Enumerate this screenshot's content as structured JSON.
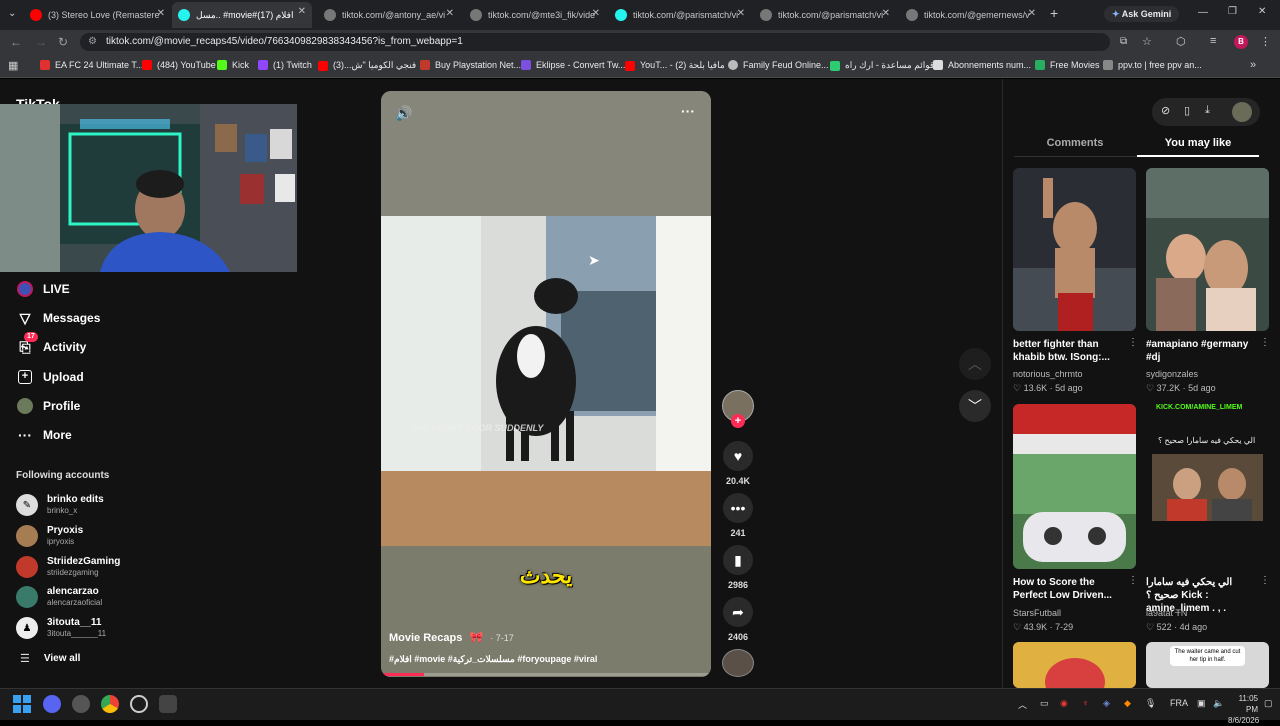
{
  "browser": {
    "tabs": [
      {
        "label": "(3) Stereo Love (Remastere",
        "color": "#ff0000"
      },
      {
        "label": "مسل.. #movie#افلام (17)",
        "color": "#25f4ee"
      },
      {
        "label": "tiktok.com/@antony_ae/vi",
        "color": "#888"
      },
      {
        "label": "tiktok.com/@mte3i_fik/vide",
        "color": "#888"
      },
      {
        "label": "tiktok.com/@parismatch/vi",
        "color": "#25f4ee"
      },
      {
        "label": "tiktok.com/@parismatch/vi",
        "color": "#888"
      },
      {
        "label": "tiktok.com/@gemernews/v",
        "color": "#888"
      }
    ],
    "new_tab": "+",
    "ask_gemini": "Ask Gemini",
    "url": "tiktok.com/@movie_recaps45/video/7663409829838343456?is_from_webapp=1",
    "bookmarks": [
      {
        "label": "EA FC 24 Ultimate T...",
        "color": "#e03030"
      },
      {
        "label": "(484) YouTube",
        "color": "#ff0000"
      },
      {
        "label": "Kick",
        "color": "#53fc18"
      },
      {
        "label": "(1) Twitch",
        "color": "#9146ff"
      },
      {
        "label": "فنجي الكوميا \"ش...(3)",
        "color": "#ff0000"
      },
      {
        "label": "Buy Playstation Net...",
        "color": "#c0392b"
      },
      {
        "label": "Eklipse - Convert Tw...",
        "color": "#7b4fe0"
      },
      {
        "label": "YouT... - مافيا بلحة (2)",
        "color": "#ff0000"
      },
      {
        "label": "Family Feud Online...",
        "color": "#bbbbbb"
      },
      {
        "label": "قوائم مساعدة - ارك راه...",
        "color": "#2ecc71"
      },
      {
        "label": "Abonnements num...",
        "color": "#dddddd"
      },
      {
        "label": "Free Movies",
        "color": "#27ae60"
      },
      {
        "label": "ppv.to | free ppv an...",
        "color": "#888888"
      }
    ]
  },
  "logo_text": "TikTok",
  "sidebar": {
    "nav": [
      {
        "label": "LIVE",
        "icon": "live-icon"
      },
      {
        "label": "Messages",
        "icon": "messages-icon"
      },
      {
        "label": "Activity",
        "icon": "activity-icon",
        "badge": "17"
      },
      {
        "label": "Upload",
        "icon": "upload-icon"
      },
      {
        "label": "Profile",
        "icon": "profile-icon"
      },
      {
        "label": "More",
        "icon": "more-icon"
      }
    ],
    "following_title": "Following accounts",
    "accounts": [
      {
        "name": "brinko edits",
        "handle": "brinko_x",
        "color": "#ddd"
      },
      {
        "name": "Pryoxis",
        "handle": "ipryoxis",
        "color": "#a67c52"
      },
      {
        "name": "StriidezGaming",
        "handle": "striidezgaming",
        "color": "#c0392b"
      },
      {
        "name": "alencarzao",
        "handle": "alencarzaoficial",
        "color": "#3a7a6a"
      },
      {
        "name": "3itouta__11",
        "handle": "3itouta______11",
        "color": "#eee"
      }
    ],
    "view_all": "View all"
  },
  "video": {
    "caption_overlay": "THE FRONT DOOR SUDDENLY",
    "subtitle": "يحدث",
    "author": "Movie Recaps",
    "date": "· 7-17",
    "hashtags": "#افلام #movie #مسلسلات_تركية #foryoupage #viral",
    "progress": 0.13
  },
  "actions": {
    "likes": "20.4K",
    "comments": "241",
    "saves": "2986",
    "shares": "2406"
  },
  "panel": {
    "tabs": [
      "Comments",
      "You may like"
    ],
    "active_tab": 1,
    "cards": [
      {
        "title": "better fighter than khabib btw. ISong:...",
        "author": "notorious_chrmto",
        "likes": "13.6K",
        "age": "5d ago"
      },
      {
        "title": "#amapiano #germany #dj",
        "author": "sydigonzales",
        "likes": "37.2K",
        "age": "5d ago"
      },
      {
        "title": "How to Score the Perfect Low Driven...",
        "author": "StarsFutball",
        "likes": "43.9K",
        "age": "7-29"
      },
      {
        "title": "الي يحكي فيه سامارا صحيح ؟ Kick : amine_limem . , .",
        "author": "la9atat TN",
        "likes": "522",
        "age": "4d ago"
      }
    ],
    "thumb_texts": {
      "kick": "KICK.COM/AMINE_LIMEM",
      "arabic_q": "الي يحكي فيه سامارا صحيح ؟",
      "waiter": "The waiter came and cut her tip in half."
    }
  },
  "taskbar": {
    "lang": "FRA",
    "time": "11:05 PM",
    "date": "8/6/2026"
  }
}
